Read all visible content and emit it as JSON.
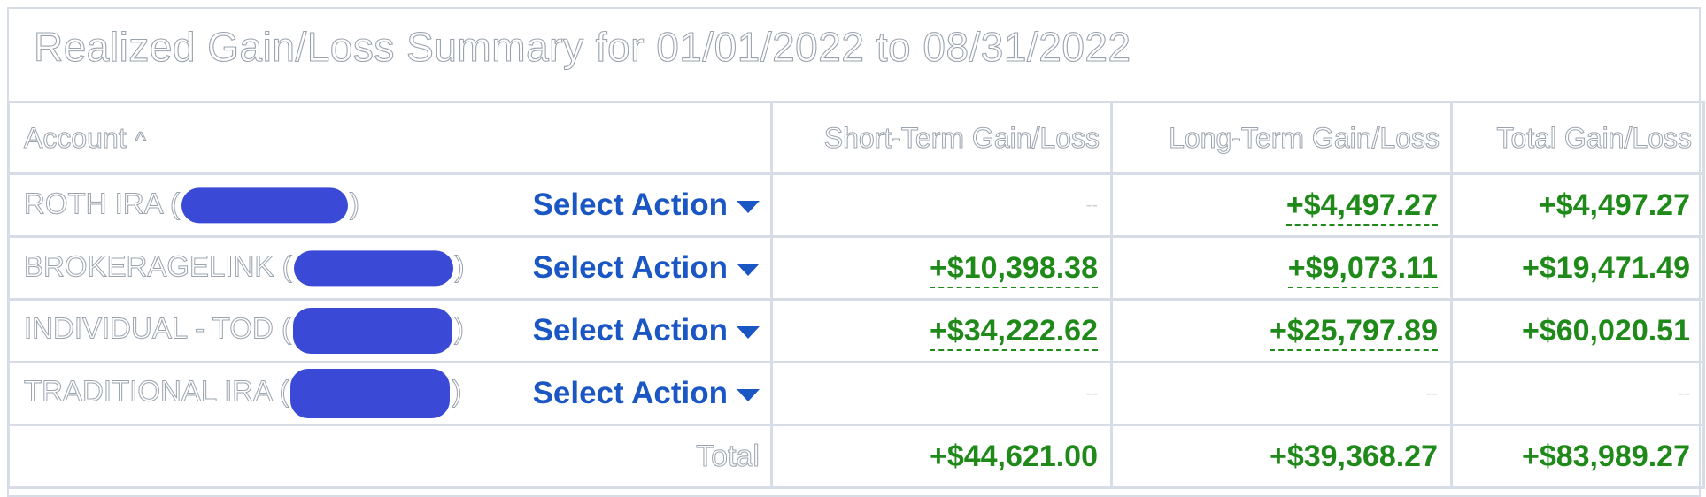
{
  "title": "Realized Gain/Loss Summary for 01/01/2022 to 08/31/2022",
  "columns": {
    "account": "Account",
    "short_term": "Short-Term Gain/Loss",
    "long_term": "Long-Term Gain/Loss",
    "total": "Total Gain/Loss"
  },
  "sort_icon": "^",
  "colors": {
    "gain": "#1f8a1a",
    "link": "#1a56c4",
    "redaction": "#3a49d6",
    "border": "#d6dde6"
  },
  "rows": [
    {
      "account": "ROTH IRA (",
      "account_close": ")",
      "action": "Select Action",
      "short_term": "--",
      "long_term": "+$4,497.27",
      "total": "+$4,497.27"
    },
    {
      "account": "BROKERAGELINK (",
      "account_close": ")",
      "action": "Select Action",
      "short_term": "+$10,398.38",
      "long_term": "+$9,073.11",
      "total": "+$19,471.49"
    },
    {
      "account": "INDIVIDUAL - TOD (",
      "account_close": ")",
      "action": "Select Action",
      "short_term": "+$34,222.62",
      "long_term": "+$25,797.89",
      "total": "+$60,020.51"
    },
    {
      "account": "TRADITIONAL IRA (",
      "account_close": ")",
      "action": "Select Action",
      "short_term": "--",
      "long_term": "--",
      "total": "--"
    }
  ],
  "totals": {
    "label": "Total",
    "short_term": "+$44,621.00",
    "long_term": "+$39,368.27",
    "total": "+$83,989.27"
  }
}
